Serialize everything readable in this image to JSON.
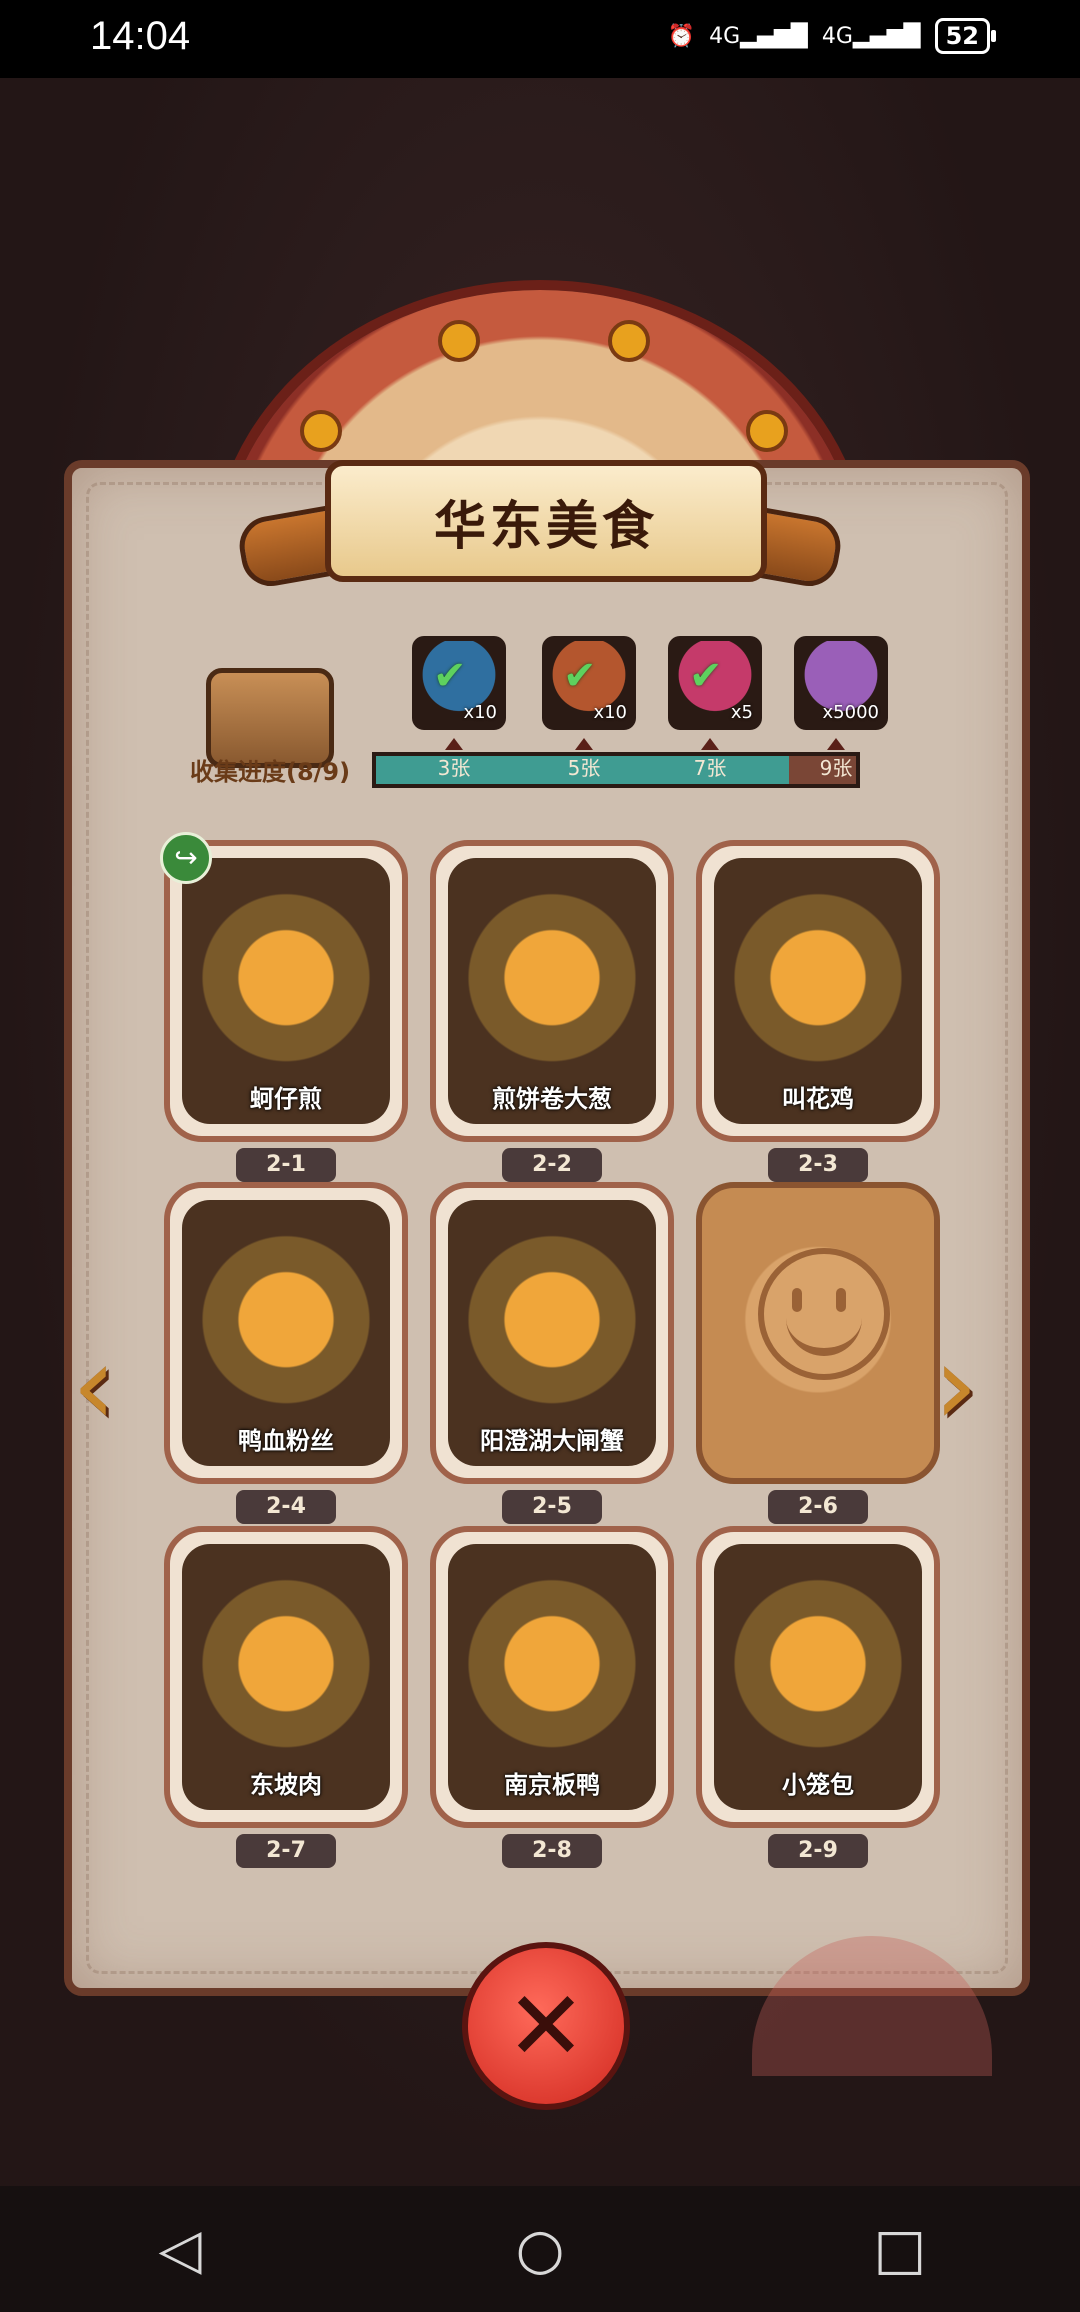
{
  "status": {
    "time": "14:04",
    "network1": "4G",
    "network2": "4G",
    "battery": "52"
  },
  "game": {
    "title": "华东美食",
    "progress_label": "收集进度(8/9)",
    "progress_fraction": 0.86,
    "ticks": [
      "3张",
      "5张",
      "7张",
      "9张"
    ],
    "rewards": [
      {
        "qty": "x10",
        "claimed": true,
        "color": "#2f6fa0"
      },
      {
        "qty": "x10",
        "claimed": true,
        "color": "#b4562e"
      },
      {
        "qty": "x5",
        "claimed": true,
        "color": "#c53a6a"
      },
      {
        "qty": "x5000",
        "claimed": false,
        "color": "#9a5fb8"
      }
    ],
    "cards": [
      {
        "id": "2-1",
        "name": "蚵仔煎",
        "locked": false
      },
      {
        "id": "2-2",
        "name": "煎饼卷大葱",
        "locked": false
      },
      {
        "id": "2-3",
        "name": "叫花鸡",
        "locked": false
      },
      {
        "id": "2-4",
        "name": "鸭血粉丝",
        "locked": false
      },
      {
        "id": "2-5",
        "name": "阳澄湖大闸蟹",
        "locked": false
      },
      {
        "id": "2-6",
        "name": "",
        "locked": true
      },
      {
        "id": "2-7",
        "name": "东坡肉",
        "locked": false
      },
      {
        "id": "2-8",
        "name": "南京板鸭",
        "locked": false
      },
      {
        "id": "2-9",
        "name": "小笼包",
        "locked": false
      }
    ],
    "icons": {
      "prev": "chevron-left-icon",
      "next": "chevron-right-icon",
      "close": "close-icon",
      "share": "share-icon"
    }
  },
  "nav": {
    "back": "◁",
    "home": "○",
    "recent": "□"
  }
}
